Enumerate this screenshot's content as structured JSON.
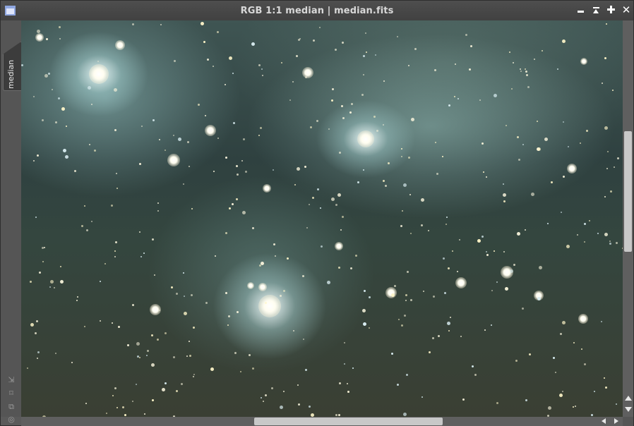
{
  "window": {
    "title": "RGB 1:1 median | median.fits",
    "app_icon": "image-window-icon",
    "controls": [
      "minimize-icon",
      "shade-icon",
      "maximize-icon",
      "close-icon"
    ],
    "close_glyph": "✕"
  },
  "view_tab": {
    "label": "median"
  },
  "side_tools": [
    {
      "name": "fit-view-icon",
      "glyph": "⇲"
    },
    {
      "name": "zoom-fit-icon",
      "glyph": "⌑"
    },
    {
      "name": "clone-view-icon",
      "glyph": "⧉"
    },
    {
      "name": "target-icon",
      "glyph": "◎"
    }
  ],
  "image": {
    "description_name": "astrophoto-canvas"
  },
  "colors": {
    "title_text": "#d8d8d8",
    "tab_background": "#3c3c3c",
    "scroll_thumb": "#c8c8c8"
  }
}
